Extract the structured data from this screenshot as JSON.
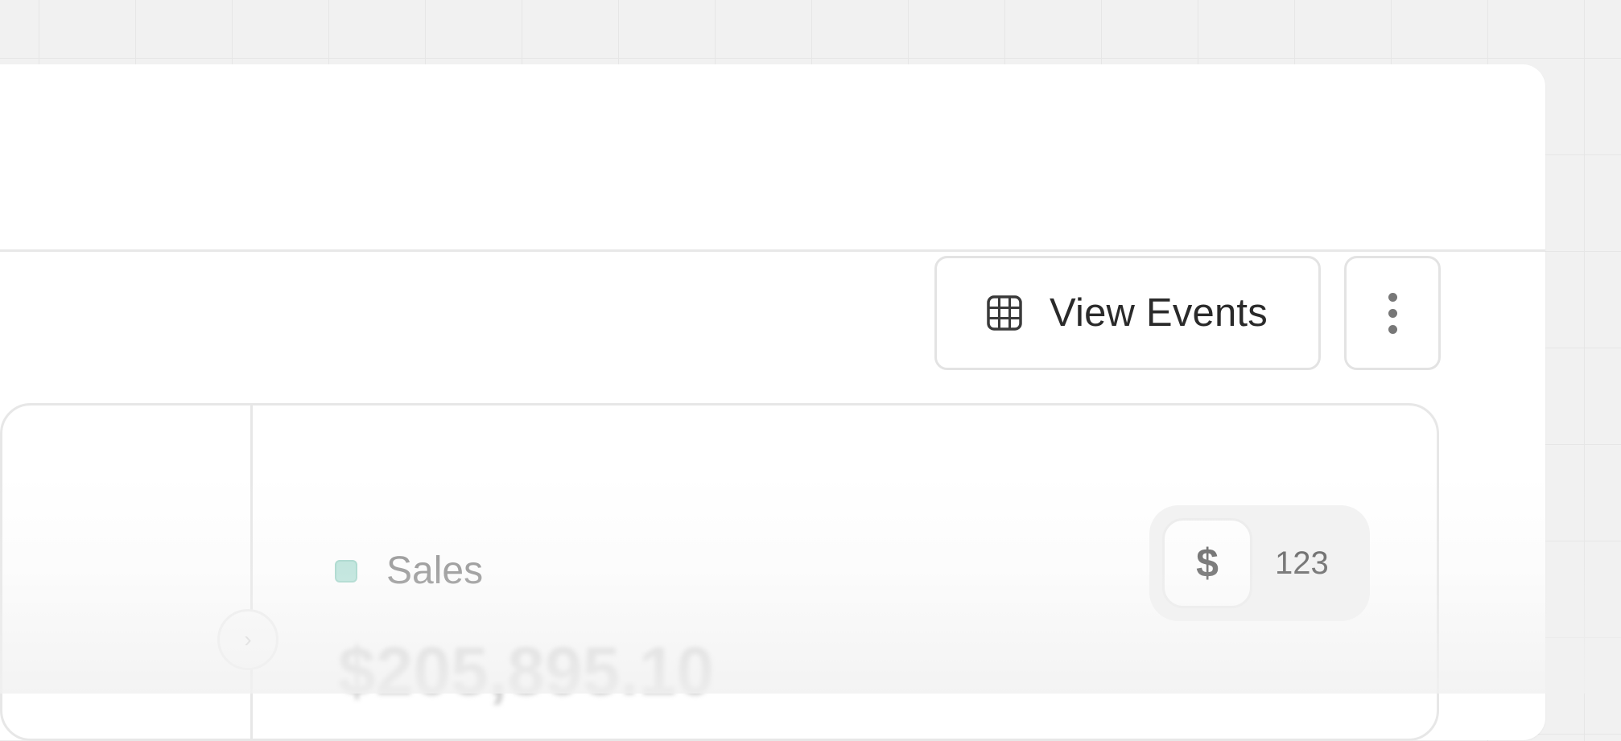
{
  "toolbar": {
    "view_events_label": "View Events",
    "view_events_icon": "table-icon",
    "more_icon": "more-vertical-icon"
  },
  "metric": {
    "label": "Sales",
    "value": "$205,895.10",
    "swatch_color": "#b5e3d9"
  },
  "unit_toggle": {
    "options": [
      "$",
      "123"
    ],
    "selected": "$"
  },
  "colors": {
    "background": "#f1f1f1",
    "panel": "#ffffff",
    "border": "#e3e3e3",
    "text": "#2a2a2a"
  }
}
